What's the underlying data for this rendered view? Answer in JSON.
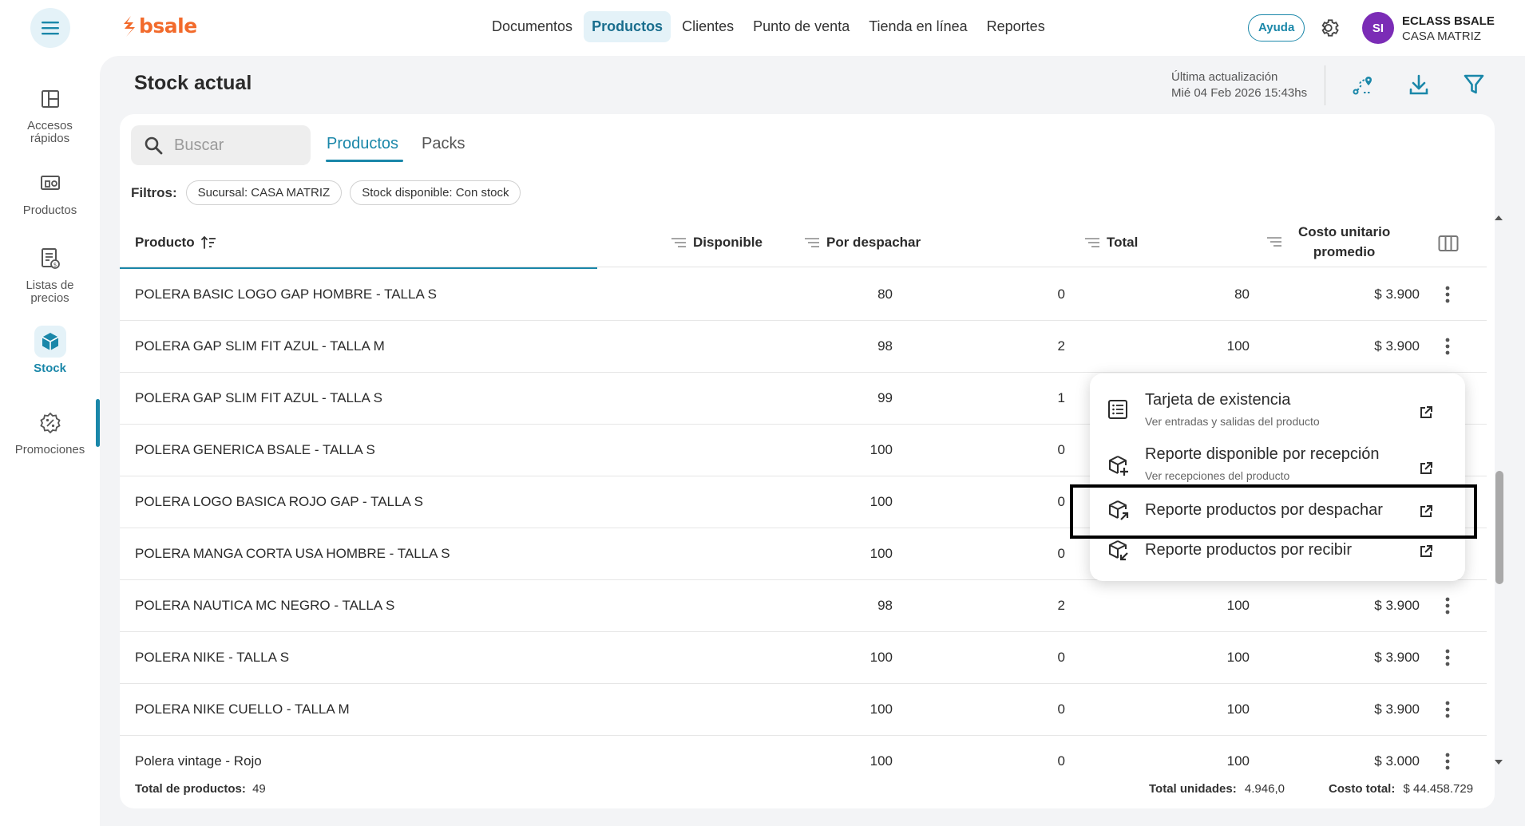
{
  "header": {
    "logo_text": "bsale",
    "nav": [
      "Documentos",
      "Productos",
      "Clientes",
      "Punto de venta",
      "Tienda en línea",
      "Reportes"
    ],
    "active_nav": "Productos",
    "help_label": "Ayuda",
    "avatar_initials": "SI",
    "user_name": "ECLASS BSALE",
    "user_branch": "CASA MATRIZ"
  },
  "sidebar": {
    "items": [
      {
        "label_1": "Accesos",
        "label_2": "rápidos",
        "icon": "layout-icon"
      },
      {
        "label_1": "Productos",
        "label_2": "",
        "icon": "products-icon"
      },
      {
        "label_1": "Listas de",
        "label_2": "precios",
        "icon": "price-list-icon"
      },
      {
        "label_1": "Stock",
        "label_2": "",
        "icon": "stock-box-icon"
      },
      {
        "label_1": "Promociones",
        "label_2": "",
        "icon": "promotion-badge-icon"
      }
    ],
    "active": "Stock"
  },
  "page": {
    "title": "Stock actual",
    "last_update_label": "Última actualización",
    "last_update_value": "Mié 04 Feb 2026 15:43hs"
  },
  "search": {
    "placeholder": "Buscar"
  },
  "tabs": [
    "Productos",
    "Packs"
  ],
  "filters": {
    "label": "Filtros:",
    "chips": [
      "Sucursal: CASA MATRIZ",
      "Stock disponible: Con stock"
    ]
  },
  "table": {
    "columns": {
      "product": "Producto",
      "available": "Disponible",
      "to_dispatch": "Por despachar",
      "total": "Total",
      "cost_1": "Costo unitario",
      "cost_2": "promedio"
    },
    "rows": [
      {
        "name": "POLERA BASIC LOGO GAP HOMBRE - TALLA S",
        "available": "80",
        "to_dispatch": "0",
        "total": "80",
        "cost": "$ 3.900"
      },
      {
        "name": "POLERA GAP SLIM FIT AZUL - TALLA M",
        "available": "98",
        "to_dispatch": "2",
        "total": "100",
        "cost": "$ 3.900"
      },
      {
        "name": "POLERA GAP SLIM FIT AZUL - TALLA S",
        "available": "99",
        "to_dispatch": "1",
        "total": "",
        "cost": ""
      },
      {
        "name": "POLERA GENERICA BSALE - TALLA S",
        "available": "100",
        "to_dispatch": "0",
        "total": "",
        "cost": ""
      },
      {
        "name": "POLERA LOGO BASICA ROJO GAP - TALLA S",
        "available": "100",
        "to_dispatch": "0",
        "total": "",
        "cost": ""
      },
      {
        "name": "POLERA MANGA CORTA USA HOMBRE - TALLA S",
        "available": "100",
        "to_dispatch": "0",
        "total": "",
        "cost": ""
      },
      {
        "name": "POLERA NAUTICA MC NEGRO - TALLA S",
        "available": "98",
        "to_dispatch": "2",
        "total": "100",
        "cost": "$ 3.900"
      },
      {
        "name": "POLERA NIKE - TALLA S",
        "available": "100",
        "to_dispatch": "0",
        "total": "100",
        "cost": "$ 3.900"
      },
      {
        "name": "POLERA NIKE CUELLO - TALLA M",
        "available": "100",
        "to_dispatch": "0",
        "total": "100",
        "cost": "$ 3.900"
      },
      {
        "name": "Polera vintage - Rojo",
        "available": "100",
        "to_dispatch": "0",
        "total": "100",
        "cost": "$ 3.000"
      }
    ]
  },
  "footer": {
    "total_products_label": "Total de productos:",
    "total_products_value": "49",
    "total_units_label": "Total unidades:",
    "total_units_value": "4.946,0",
    "total_cost_label": "Costo total:",
    "total_cost_value": "$ 44.458.729"
  },
  "context_menu": {
    "items": [
      {
        "title": "Tarjeta de existencia",
        "subtitle": "Ver entradas y salidas del producto"
      },
      {
        "title": "Reporte disponible por recepción",
        "subtitle": "Ver recepciones del producto"
      },
      {
        "title": "Reporte productos por despachar",
        "subtitle": ""
      },
      {
        "title": "Reporte productos por recibir",
        "subtitle": ""
      }
    ],
    "highlighted": "Reporte productos por despachar"
  },
  "colors": {
    "brand_orange": "#f26a2b",
    "accent_teal": "#1a87a9",
    "avatar_purple": "#7b2cb6"
  }
}
